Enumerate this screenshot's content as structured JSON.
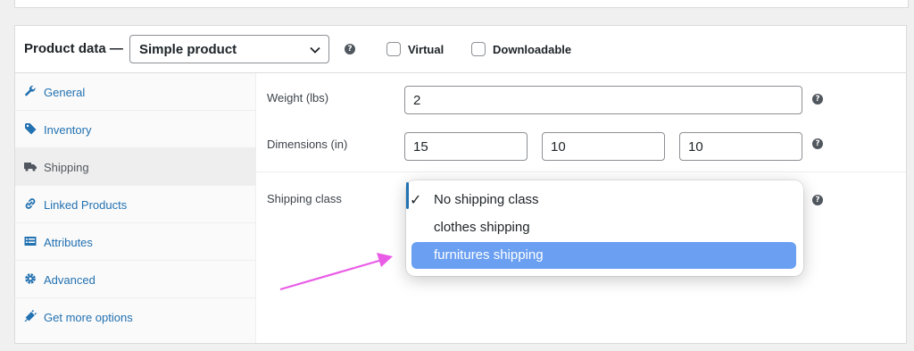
{
  "header": {
    "title": "Product data —",
    "product_type": "Simple product",
    "virtual_label": "Virtual",
    "downloadable_label": "Downloadable",
    "help_glyph": "?"
  },
  "tabs": [
    {
      "label": "General",
      "icon": "wrench-icon",
      "active": false
    },
    {
      "label": "Inventory",
      "icon": "tag-icon",
      "active": false
    },
    {
      "label": "Shipping",
      "icon": "truck-icon",
      "active": true
    },
    {
      "label": "Linked Products",
      "icon": "link-icon",
      "active": false
    },
    {
      "label": "Attributes",
      "icon": "list-icon",
      "active": false
    },
    {
      "label": "Advanced",
      "icon": "gear-icon",
      "active": false
    },
    {
      "label": "Get more options",
      "icon": "plugin-icon",
      "active": false
    }
  ],
  "shipping": {
    "weight_label": "Weight (lbs)",
    "weight_value": "2",
    "dimensions_label": "Dimensions (in)",
    "length": "15",
    "width": "10",
    "height": "10",
    "shipping_class_label": "Shipping class",
    "options": [
      {
        "label": "No shipping class",
        "checked": true,
        "highlighted": false
      },
      {
        "label": "clothes shipping",
        "checked": false,
        "highlighted": false
      },
      {
        "label": "furnitures shipping",
        "checked": false,
        "highlighted": true
      }
    ],
    "check_glyph": "✓"
  },
  "colors": {
    "link": "#2271b1",
    "highlight": "#6a9ff2",
    "arrow": "#e95ce6"
  }
}
